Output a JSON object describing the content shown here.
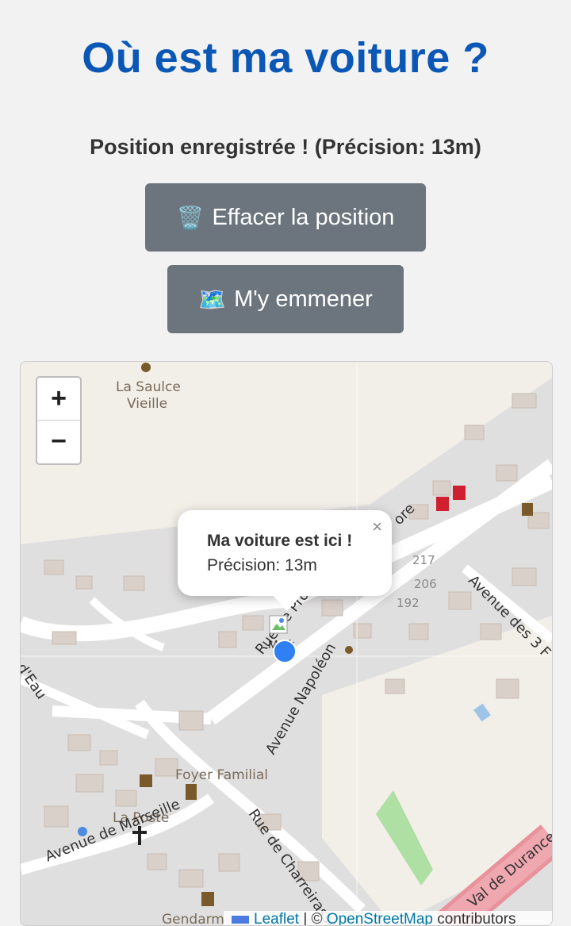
{
  "page": {
    "title": "Où est ma voiture ?",
    "status": "Position enregistrée ! (Précision: 13m)"
  },
  "buttons": {
    "clear_icon": "🗑️",
    "clear_label": "Effacer la position",
    "go_icon": "🗺️",
    "go_label": "M'y emmener"
  },
  "map": {
    "zoom_in": "+",
    "zoom_out": "−",
    "popup": {
      "title": "Ma voiture est ici !",
      "precision": "Précision: 13m",
      "close": "×"
    },
    "marker_alt": "Mark",
    "place_labels": {
      "la_saulce_1": "La Saulce",
      "la_saulce_2": "Vieille",
      "foyer": "Foyer Familial",
      "la_poste": "La Poste",
      "gendarmerie": "Gendarm"
    },
    "road_labels": {
      "rue_provence": "Rue de Provence",
      "av_napoleon": "Avenue Napoléon",
      "av_marseille": "Avenue de Marseille",
      "rue_charreirasse": "Rue de Charreirasse",
      "av_3f": "Avenue des 3 F",
      "val_durance": "Val de Durance",
      "eau": "u d'Eau",
      "ore": "ore"
    },
    "house_numbers": [
      "217",
      "206",
      "192"
    ],
    "attribution": {
      "leaflet": "Leaflet",
      "sep": " | © ",
      "osm": "OpenStreetMap",
      "contrib": " contributors"
    }
  }
}
